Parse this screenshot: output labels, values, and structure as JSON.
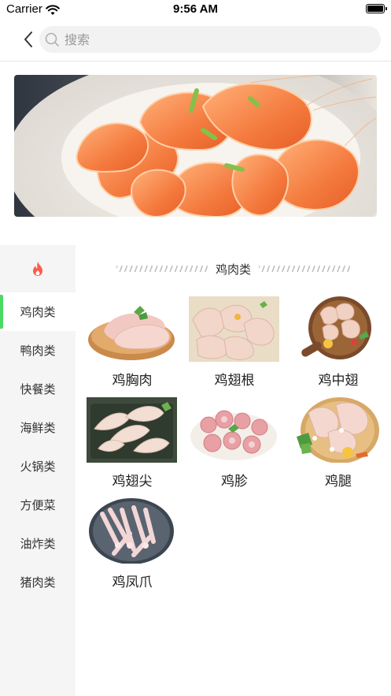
{
  "status_bar": {
    "carrier": "Carrier",
    "time": "9:56 AM"
  },
  "search": {
    "placeholder": "搜索"
  },
  "sidebar": {
    "hot_icon": "fire-icon",
    "items": [
      {
        "label": "鸡肉类",
        "active": true
      },
      {
        "label": "鸭肉类",
        "active": false
      },
      {
        "label": "快餐类",
        "active": false
      },
      {
        "label": "海鲜类",
        "active": false
      },
      {
        "label": "火锅类",
        "active": false
      },
      {
        "label": "方便菜",
        "active": false
      },
      {
        "label": "油炸类",
        "active": false
      },
      {
        "label": "猪肉类",
        "active": false
      }
    ]
  },
  "section": {
    "title": "鸡肉类"
  },
  "products": [
    {
      "name": "鸡胸肉"
    },
    {
      "name": "鸡翅根"
    },
    {
      "name": "鸡中翅"
    },
    {
      "name": "鸡翅尖"
    },
    {
      "name": "鸡胗"
    },
    {
      "name": "鸡腿"
    },
    {
      "name": "鸡凤爪"
    }
  ],
  "colors": {
    "accent": "#4cd964",
    "hot": "#ff5a4e",
    "sidebar_bg": "#f5f5f5"
  }
}
